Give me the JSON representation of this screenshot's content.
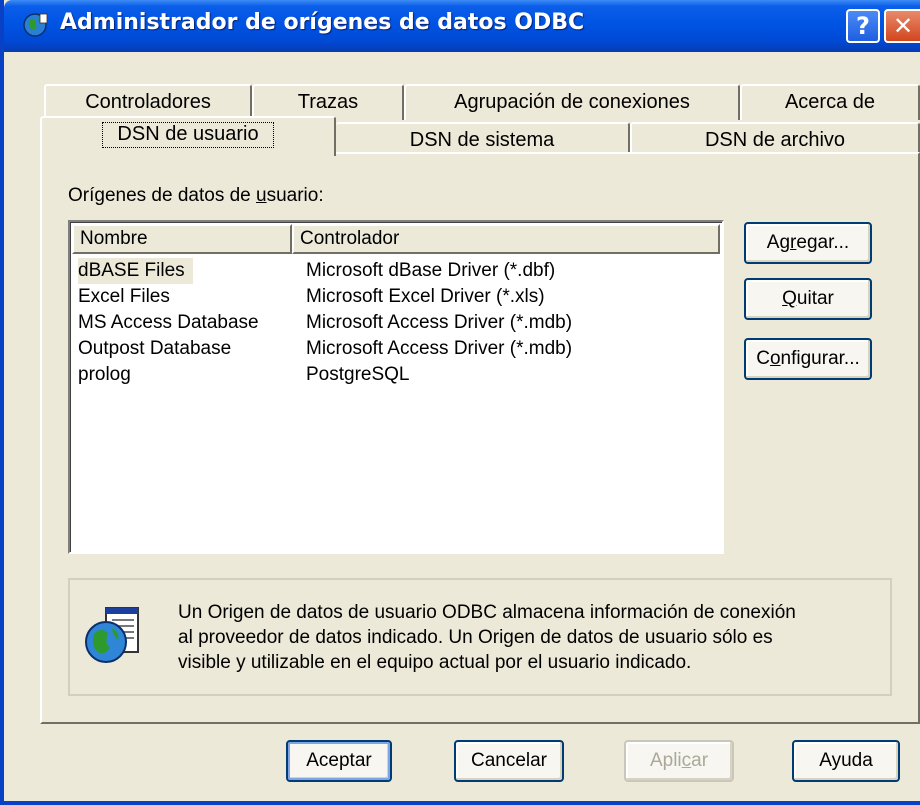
{
  "window": {
    "title": "Administrador de orígenes de datos ODBC",
    "help_button": "?",
    "close_button": "✕"
  },
  "tabs": {
    "row1": [
      "Controladores",
      "Trazas",
      "Agrupación de conexiones",
      "Acerca de"
    ],
    "row2": [
      "DSN de usuario",
      "DSN de sistema",
      "DSN de archivo"
    ],
    "selected": "DSN de usuario"
  },
  "panel": {
    "list_caption_pre": "Orígenes de datos de ",
    "list_caption_mnemonic": "u",
    "list_caption_post": "suario:",
    "columns": [
      "Nombre",
      "Controlador"
    ],
    "rows": [
      {
        "name": "dBASE Files",
        "driver": "Microsoft dBase Driver (*.dbf)"
      },
      {
        "name": "Excel Files",
        "driver": "Microsoft Excel Driver (*.xls)"
      },
      {
        "name": "MS Access Database",
        "driver": "Microsoft Access Driver (*.mdb)"
      },
      {
        "name": "Outpost Database",
        "driver": "Microsoft Access Driver (*.mdb)"
      },
      {
        "name": "prolog",
        "driver": "PostgreSQL"
      }
    ],
    "buttons": {
      "add": {
        "pre": "Ag",
        "mn": "r",
        "post": "egar..."
      },
      "remove": {
        "pre": "",
        "mn": "Q",
        "post": "uitar"
      },
      "configure": {
        "pre": "C",
        "mn": "o",
        "post": "nfigurar..."
      }
    },
    "info_lines": [
      "Un Origen de datos de usuario ODBC almacena información de conexión",
      "al proveedor de datos indicado. Un Origen de datos de usuario sólo es",
      "visible y utilizable en el equipo actual por el usuario indicado."
    ]
  },
  "footer": {
    "ok": "Aceptar",
    "cancel": "Cancelar",
    "apply": {
      "pre": "Apli",
      "mn": "c",
      "post": "ar",
      "disabled": true
    },
    "help": "Ayuda"
  },
  "colors": {
    "titlebar": "#0054e3",
    "face": "#ece9d8",
    "button_border": "#003c74"
  }
}
